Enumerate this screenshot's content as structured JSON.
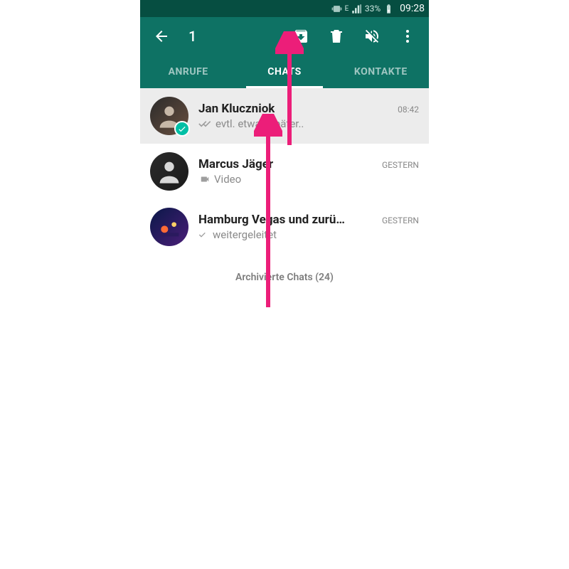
{
  "statusbar": {
    "network_type": "E",
    "battery_pct": "33%",
    "time": "09:28"
  },
  "toolbar": {
    "selected_count": "1"
  },
  "tabs": {
    "calls": "ANRUFE",
    "chats": "CHATS",
    "contacts": "KONTAKTE"
  },
  "chats": [
    {
      "name": "Jan Kluczniok",
      "preview": "evtl. etwas später..",
      "time": "08:42",
      "selected": true,
      "status_icon": "double-check",
      "media_icon": null
    },
    {
      "name": "Marcus Jäger",
      "preview": "Video",
      "time": "GESTERN",
      "selected": false,
      "status_icon": null,
      "media_icon": "video"
    },
    {
      "name": "Hamburg Vegas und zurü…",
      "preview": "weitergeleitet",
      "time": "GESTERN",
      "selected": false,
      "status_icon": "single-check",
      "media_icon": null
    }
  ],
  "archived": {
    "label": "Archivierte Chats (24)"
  }
}
